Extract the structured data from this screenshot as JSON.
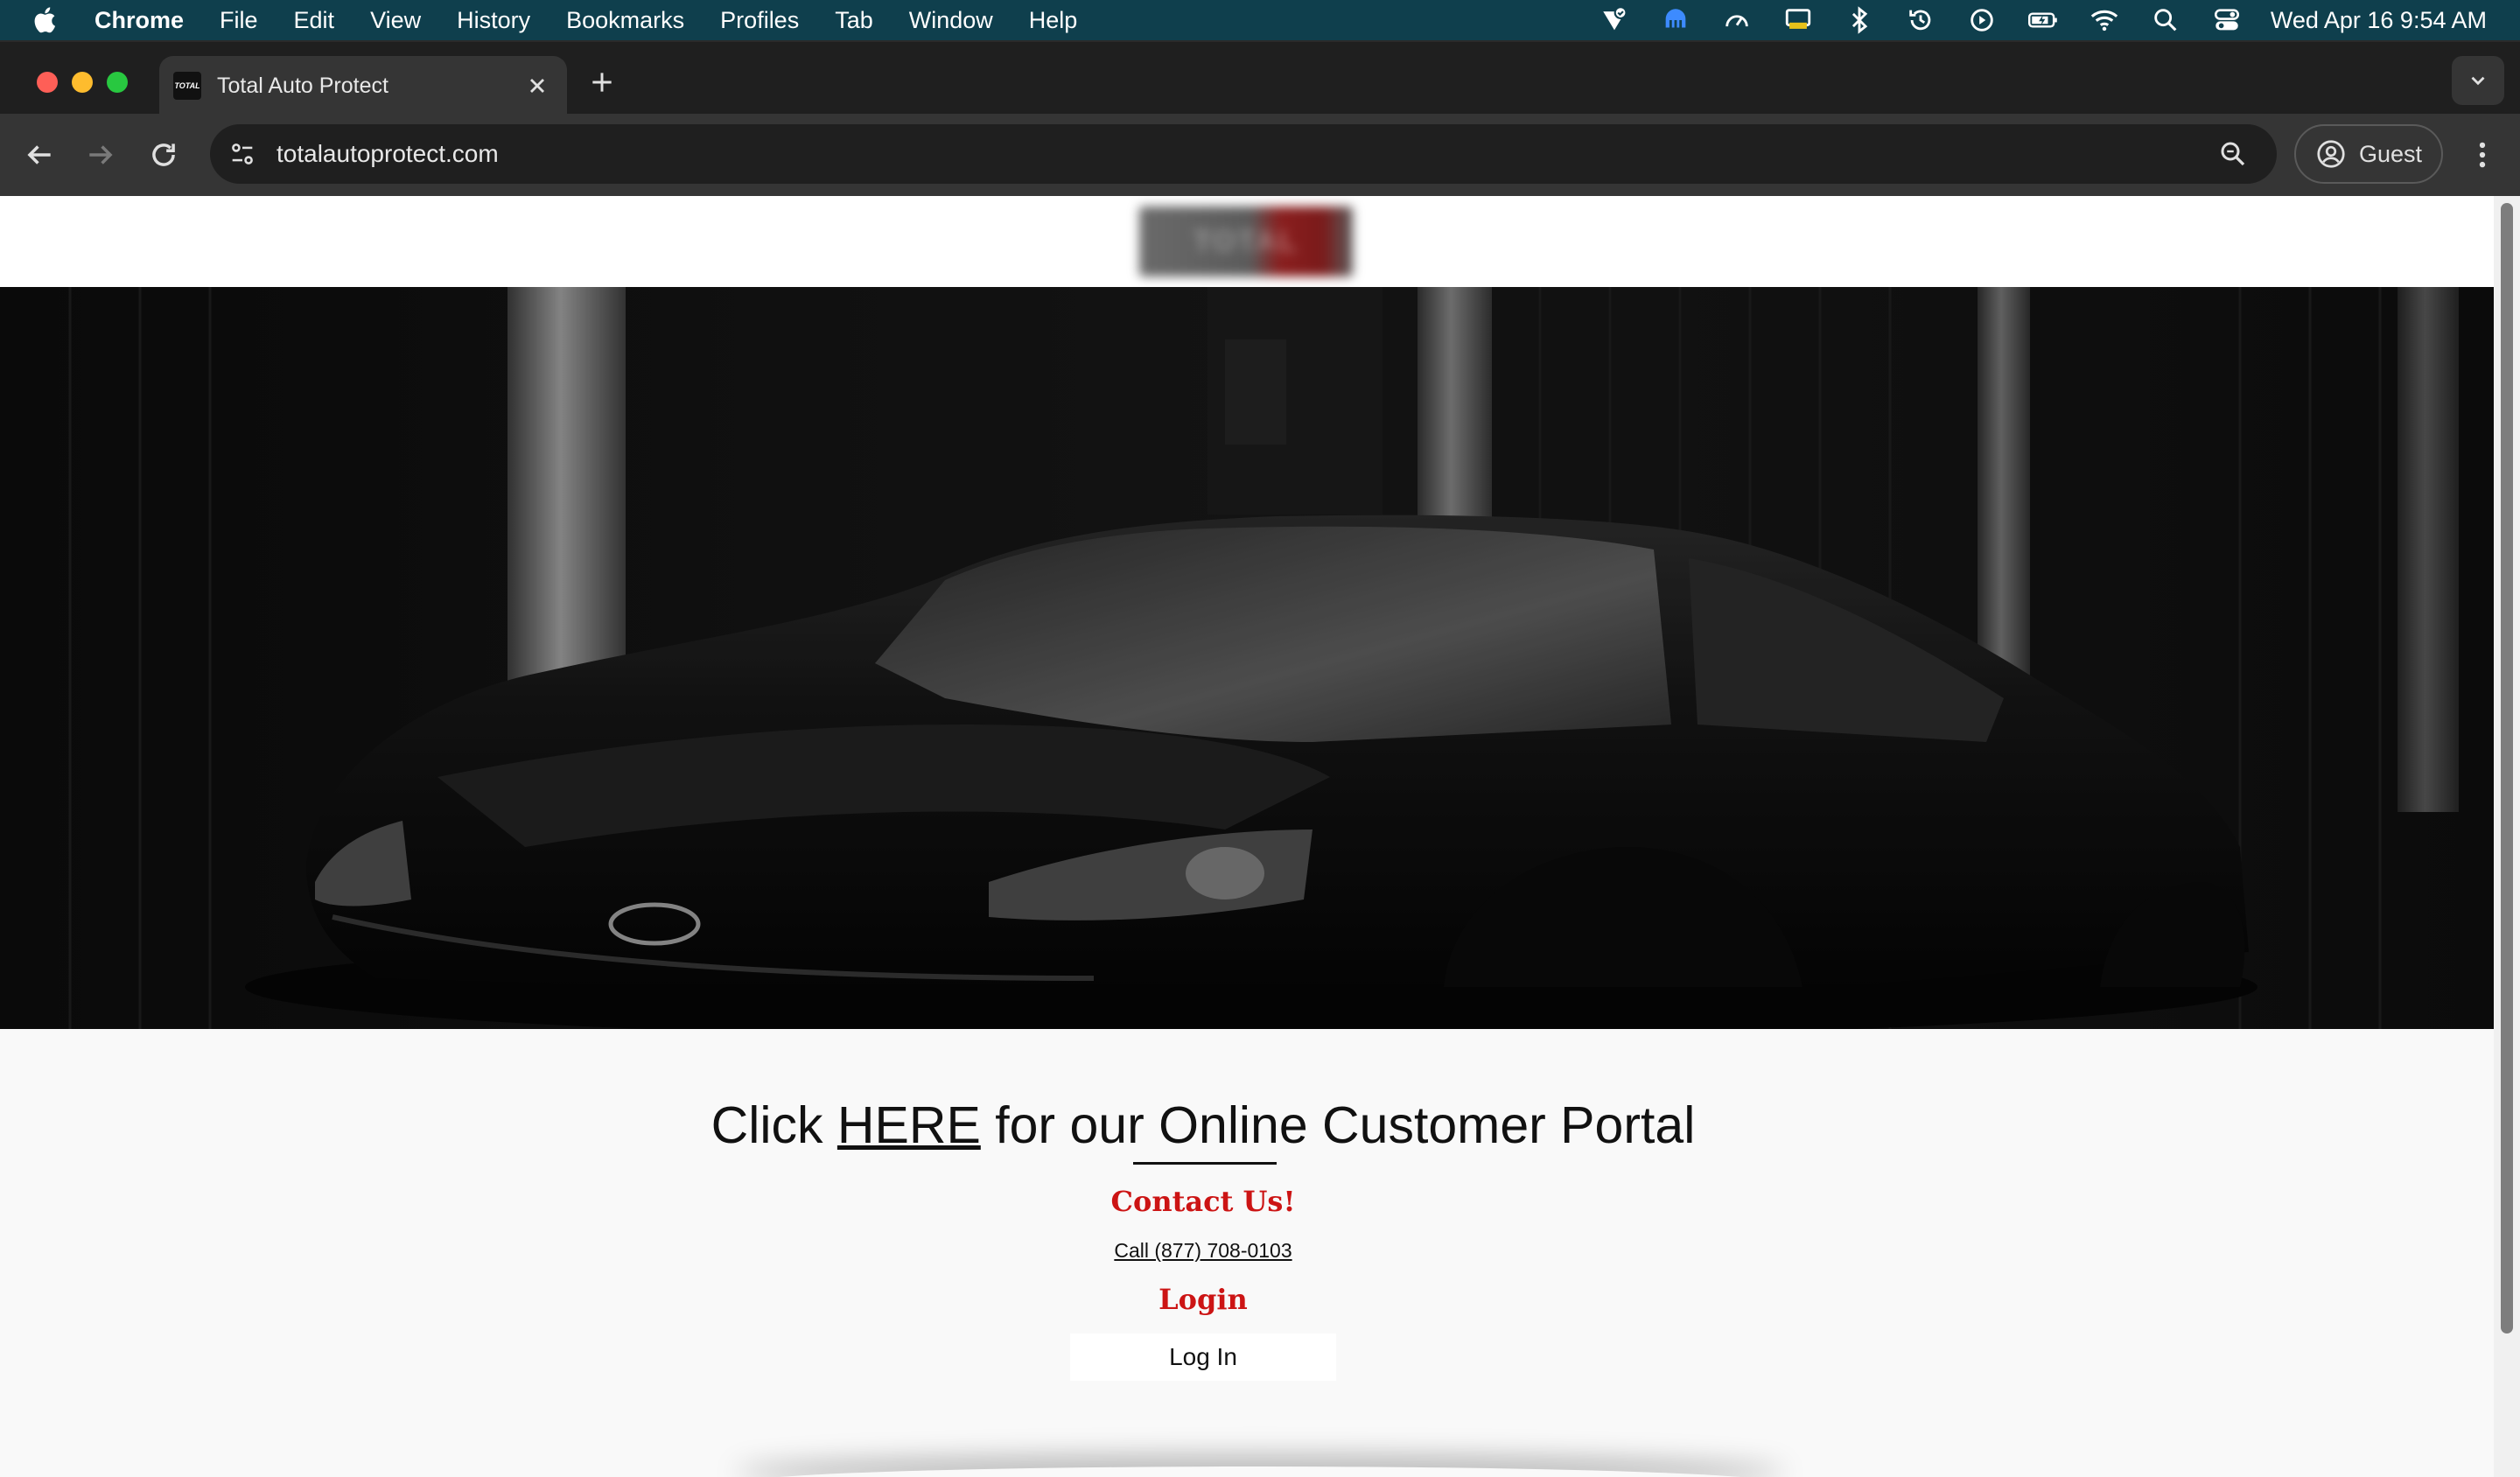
{
  "menubar": {
    "app_name": "Chrome",
    "items": [
      "File",
      "Edit",
      "View",
      "History",
      "Bookmarks",
      "Profiles",
      "Tab",
      "Window",
      "Help"
    ],
    "clock": "Wed Apr 16  9:54 AM",
    "status_icons": [
      "vpn-check-icon",
      "cloud-app-icon",
      "gauge-icon",
      "display-icon",
      "bluetooth-icon",
      "time-machine-icon",
      "play-circle-icon",
      "battery-charging-icon",
      "wifi-icon",
      "spotlight-search-icon",
      "control-center-icon"
    ]
  },
  "tabs": [
    {
      "title": "Total Auto Protect",
      "favicon_text": "TOTAL",
      "active": true
    }
  ],
  "toolbar": {
    "url": "totalautoprotect.com",
    "profile_label": "Guest"
  },
  "page": {
    "logo_text": "TOTAL",
    "portal_prefix": "Click ",
    "portal_link": "HERE",
    "portal_suffix": " for our Online Customer Portal",
    "contact_heading": "Contact Us!",
    "phone_link": "Call (877) 708-0103",
    "login_heading": "Login",
    "login_button": "Log In"
  },
  "colors": {
    "menubar_bg": "#0f3f4d",
    "browser_chrome": "#353535",
    "accent_red": "#cc1414",
    "page_bg": "#f9f9f9"
  }
}
